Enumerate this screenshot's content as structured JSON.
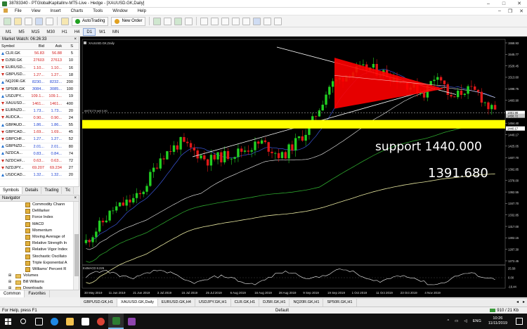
{
  "window": {
    "title": "38783340 - PTGlobalKapitalInv-MT5-Live - Hedge - [XAUUSD.GK,Daily]",
    "controls": [
      "–",
      "□",
      "✕"
    ]
  },
  "menu": {
    "items": [
      "File",
      "View",
      "Insert",
      "Charts",
      "Tools",
      "Window",
      "Help"
    ],
    "mdi_controls": [
      "–",
      "❐",
      "✕"
    ]
  },
  "toolbar": {
    "autotrading_label": "AutoTrading",
    "new_order_label": "New Order"
  },
  "timeframes": {
    "items": [
      "M1",
      "M5",
      "M15",
      "M30",
      "H1",
      "H4",
      "D1",
      "W1",
      "MN"
    ],
    "active": "D1"
  },
  "market_watch": {
    "title": "Market Watch: 06:26:33",
    "close": "×",
    "columns": {
      "symbol": "Symbol",
      "bid": "Bid",
      "ask": "Ask",
      "spread": "S"
    },
    "rows": [
      {
        "symbol": "CLR.GK",
        "bid": "56.83",
        "ask": "56.88",
        "spread": "5",
        "dir": "up",
        "color": "red"
      },
      {
        "symbol": "DJ5R.GK",
        "bid": "27603",
        "ask": "27613",
        "spread": "10",
        "dir": "down",
        "color": "red"
      },
      {
        "symbol": "EURUSD...",
        "bid": "1.10...",
        "ask": "1.10...",
        "spread": "16",
        "dir": "down",
        "color": "red"
      },
      {
        "symbol": "GBPUSD...",
        "bid": "1.27...",
        "ask": "1.27...",
        "spread": "18",
        "dir": "down",
        "color": "red"
      },
      {
        "symbol": "NQ20R.GK",
        "bid": "8230...",
        "ask": "8232...",
        "spread": "200",
        "dir": "up",
        "color": "blue"
      },
      {
        "symbol": "SP50R.GK",
        "bid": "3084...",
        "ask": "3085...",
        "spread": "100",
        "dir": "down",
        "color": "blue"
      },
      {
        "symbol": "USDJPY...",
        "bid": "109.1...",
        "ask": "109.1...",
        "spread": "19",
        "dir": "up",
        "color": "red"
      },
      {
        "symbol": "XAUUSD...",
        "bid": "1461...",
        "ask": "1461...",
        "spread": "400",
        "dir": "down",
        "color": "red"
      },
      {
        "symbol": "EURNZD...",
        "bid": "1.73...",
        "ask": "1.73...",
        "spread": "20",
        "dir": "down",
        "color": "blue"
      },
      {
        "symbol": "AUDCA...",
        "bid": "0.90...",
        "ask": "0.90...",
        "spread": "24",
        "dir": "down",
        "color": "red"
      },
      {
        "symbol": "GBPAUD...",
        "bid": "1.86...",
        "ask": "1.86...",
        "spread": "55",
        "dir": "up",
        "color": "blue"
      },
      {
        "symbol": "GBPCAD...",
        "bid": "1.69...",
        "ask": "1.69...",
        "spread": "45",
        "dir": "down",
        "color": "red"
      },
      {
        "symbol": "GBPCHF...",
        "bid": "1.27...",
        "ask": "1.27...",
        "spread": "52",
        "dir": "down",
        "color": "blue"
      },
      {
        "symbol": "GBPNZD...",
        "bid": "2.01...",
        "ask": "2.01...",
        "spread": "80",
        "dir": "up",
        "color": "blue"
      },
      {
        "symbol": "NZDCA...",
        "bid": "0.83...",
        "ask": "0.84...",
        "spread": "74",
        "dir": "up",
        "color": "blue"
      },
      {
        "symbol": "NZDCHF...",
        "bid": "0.63...",
        "ask": "0.63...",
        "spread": "72",
        "dir": "down",
        "color": "red"
      },
      {
        "symbol": "NZDJPY...",
        "bid": "69.207",
        "ask": "69.234",
        "spread": "27",
        "dir": "down",
        "color": "red"
      },
      {
        "symbol": "USDCAD...",
        "bid": "1.32...",
        "ask": "1.32...",
        "spread": "20",
        "dir": "up",
        "color": "blue"
      }
    ],
    "tabs": [
      "Symbols",
      "Details",
      "Trading",
      "Tic"
    ]
  },
  "navigator": {
    "title": "Navigator",
    "close": "×",
    "indicators": [
      "Commodity Chann",
      "DeMarker",
      "Force Index",
      "MACD",
      "Momentum",
      "Moving Average of",
      "Relative Strength In",
      "Relative Vigor Index",
      "Stochastic Oscillato",
      "Triple Exponential A",
      "Williams' Percent R"
    ],
    "folders": [
      "Volumes",
      "Bill Williams",
      "Downloads"
    ],
    "tabs": [
      "Common",
      "Favorites"
    ]
  },
  "chart": {
    "symbol_label": "XAUUSD.GK,Daily",
    "order_line_label": "#M76179 sell 0.80",
    "osc_label": "ExtMACD 8.226",
    "annotation_support": "support 1440.000",
    "annotation_level": "1391.680",
    "price_ticks": [
      "1558.93",
      "1545.77",
      "1528.45",
      "1513.60",
      "1498.75",
      "1483.90",
      "1469.25",
      "1454.40",
      "1440.17",
      "1425.05",
      "1407.70",
      "1392.85",
      "1378.00",
      "1362.55",
      "1347.70",
      "1332.85",
      "1317.00",
      "1302.15",
      "1287.30",
      "1272.45"
    ],
    "price_tags": {
      "current": "1461.96",
      "line2": "1458.72",
      "support": "1440.17"
    },
    "osc_ticks": [
      "25.58",
      "0.00",
      "-16.44"
    ],
    "date_ticks": [
      "30 May 2019",
      "11 Jun 2019",
      "21 Jun 2019",
      "3 Jul 2019",
      "15 Jul 2019",
      "25 Jul 2019",
      "6 Aug 2019",
      "16 Aug 2019",
      "28 Aug 2019",
      "9 Sep 2019",
      "19 Sep 2019",
      "1 Oct 2019",
      "11 Oct 2019",
      "23 Oct 2019",
      "4 Nov 2019"
    ],
    "bg_color": "#000000",
    "bull_color": "#22d022",
    "bear_color": "#e01818",
    "support_color": "#ffff00",
    "triangle_color": "#ff0000"
  },
  "chart_tabs": {
    "items": [
      "GBPUSD.GK,H1",
      "XAUUSD.GK,Daily",
      "EURUSD.GK,H4",
      "USDJPY.GK,H1",
      "CLR.GK,H1",
      "DJ5R.GK,H1",
      "NQ20R.GK,H1",
      "SP50R.GK,H1"
    ],
    "active": "XAUUSD.GK,Daily"
  },
  "status": {
    "help": "For Help, press F1",
    "profile": "Default",
    "connection": "910 / 21 Kb"
  },
  "taskbar": {
    "tray_lang": "ENG",
    "time": "10:26",
    "date": "11/11/2019"
  }
}
